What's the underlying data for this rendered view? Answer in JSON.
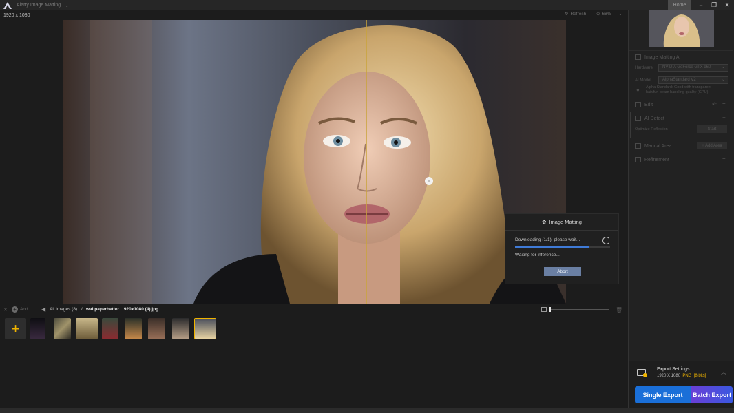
{
  "titlebar": {
    "app_name": "Aiarty Image Matting",
    "home_label": "Home"
  },
  "canvas": {
    "resolution": "1920 x 1080",
    "refresh_label": "Refresh",
    "zoom_label": "68%"
  },
  "dialog": {
    "title": "Image Matting",
    "downloading_text": "Downloading (1/1), please wait...",
    "progress": 0.78,
    "waiting_text": "Waiting for inference...",
    "abort_label": "Abort"
  },
  "bottom_bar": {
    "add_label": "Add",
    "all_images_label": "All Images (8)",
    "separator": "/",
    "current_file": "wallpaperbetter....920x1080 (4).jpg"
  },
  "thumbnails": [
    {
      "name": "thumb-1",
      "selected": false
    },
    {
      "name": "thumb-2",
      "selected": false
    },
    {
      "name": "thumb-3",
      "selected": false
    },
    {
      "name": "thumb-4",
      "selected": false
    },
    {
      "name": "thumb-5",
      "selected": false
    },
    {
      "name": "thumb-6",
      "selected": false
    },
    {
      "name": "thumb-7",
      "selected": false
    },
    {
      "name": "thumb-8",
      "selected": true
    }
  ],
  "right_panel": {
    "matting_title": "Image Matting AI",
    "hardware_label": "Hardware",
    "hardware_value": "NVIDIA GeForce GTX 960",
    "ai_model_label": "AI Model",
    "ai_model_value": "AlphaStandard  V2",
    "model_hint_1": "Alpha Standard: Good with transparent",
    "model_hint_2": "hair/fur, beam handling quality (GPU)",
    "edit_title": "Edit",
    "ai_detect_title": "AI Detect",
    "ai_detect_text": "Optimize Reflection",
    "start_label": "Start",
    "manual_area_title": "Manual Area",
    "add_area_label": "+ Add Area",
    "refinement_title": "Refinement"
  },
  "export": {
    "title": "Export Settings",
    "resolution": "1920 X 1080",
    "format": "PNG",
    "bits": "[8 bits]",
    "single_label": "Single Export",
    "batch_label": "Batch Export"
  },
  "colors": {
    "accent": "#f0b400",
    "single_export": "#1a6fd8",
    "batch_export": "#5a4ad8",
    "progress": "#3f7ad6"
  }
}
